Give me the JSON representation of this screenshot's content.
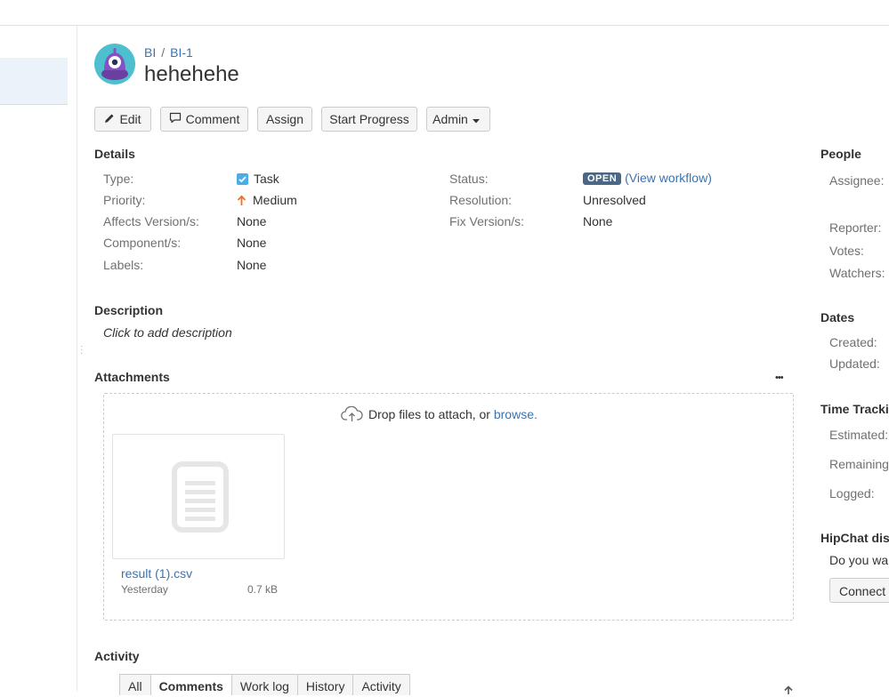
{
  "breadcrumb": {
    "project": "BI",
    "separator": "/",
    "issue_key": "BI-1"
  },
  "issue": {
    "title": "hehehehe"
  },
  "toolbar": {
    "edit": "Edit",
    "comment": "Comment",
    "assign": "Assign",
    "start_progress": "Start Progress",
    "admin": "Admin"
  },
  "details": {
    "heading": "Details",
    "type_label": "Type:",
    "type_value": "Task",
    "priority_label": "Priority:",
    "priority_value": "Medium",
    "affects_label": "Affects Version/s:",
    "affects_value": "None",
    "component_label": "Component/s:",
    "component_value": "None",
    "labels_label": "Labels:",
    "labels_value": "None",
    "status_label": "Status:",
    "status_value": "OPEN",
    "view_workflow_open": "(",
    "view_workflow": "View workflow",
    "view_workflow_close": ")",
    "resolution_label": "Resolution:",
    "resolution_value": "Unresolved",
    "fix_label": "Fix Version/s:",
    "fix_value": "None"
  },
  "description": {
    "heading": "Description",
    "placeholder": "Click to add description"
  },
  "attachments": {
    "heading": "Attachments",
    "more": "•••",
    "drop_text": "Drop files to attach, or ",
    "browse": "browse.",
    "files": [
      {
        "name": "result (1).csv",
        "date": "Yesterday",
        "size": "0.7 kB"
      }
    ]
  },
  "activity": {
    "heading": "Activity",
    "tabs": [
      "All",
      "Comments",
      "Work log",
      "History",
      "Activity"
    ],
    "active_tab": "Comments"
  },
  "sidebar": {
    "people_heading": "People",
    "assignee_label": "Assignee:",
    "reporter_label": "Reporter:",
    "votes_label": "Votes:",
    "watchers_label": "Watchers:",
    "dates_heading": "Dates",
    "created_label": "Created:",
    "updated_label": "Updated:",
    "time_heading": "Time Trackin",
    "estimated_label": "Estimated:",
    "remaining_label": "Remaining:",
    "logged_label": "Logged:",
    "hipchat_heading": "HipChat disc",
    "hipchat_text": "Do you war",
    "connect_button": "Connect"
  },
  "colors": {
    "accent": "#3b73af",
    "status_open": "#4a6785",
    "priority_medium": "#e9732a",
    "task_icon": "#4bade8"
  },
  "icons": [
    "project-avatar-icon",
    "pencil-icon",
    "comment-icon",
    "caret-down-icon",
    "task-checkbox-icon",
    "arrow-up-icon",
    "cloud-upload-icon",
    "file-icon",
    "scroll-up-icon"
  ]
}
